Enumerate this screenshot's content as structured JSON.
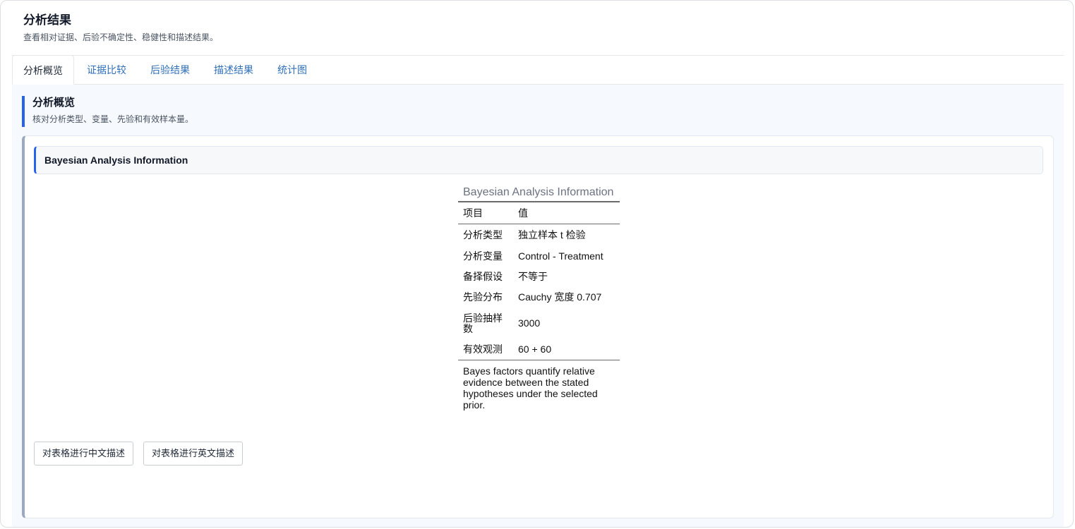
{
  "header": {
    "title": "分析结果",
    "subtitle": "查看相对证据、后验不确定性、稳健性和描述结果。"
  },
  "tabs": [
    {
      "label": "分析概览",
      "active": true
    },
    {
      "label": "证据比较",
      "active": false
    },
    {
      "label": "后验结果",
      "active": false
    },
    {
      "label": "描述结果",
      "active": false
    },
    {
      "label": "统计图",
      "active": false
    }
  ],
  "section": {
    "title": "分析概览",
    "subtitle": "核对分析类型、变量、先验和有效样本量。"
  },
  "card": {
    "header": "Bayesian Analysis Information"
  },
  "table": {
    "caption": "Bayesian Analysis Information",
    "columns": [
      "项目",
      "值"
    ],
    "rows": [
      [
        "分析类型",
        "独立样本 t 检验"
      ],
      [
        "分析变量",
        "Control - Treatment"
      ],
      [
        "备择假设",
        "不等于"
      ],
      [
        "先验分布",
        "Cauchy 宽度 0.707"
      ],
      [
        "后验抽样数",
        "3000"
      ],
      [
        "有效观测",
        "60 + 60"
      ]
    ],
    "note": "Bayes factors quantify relative evidence between the stated hypotheses under the selected prior."
  },
  "buttons": {
    "describe_cn": "对表格进行中文描述",
    "describe_en": "对表格进行英文描述"
  },
  "colors": {
    "accent": "#2563eb",
    "tab_link": "#2f6fb7",
    "panel_bg": "#f6f9fd"
  }
}
